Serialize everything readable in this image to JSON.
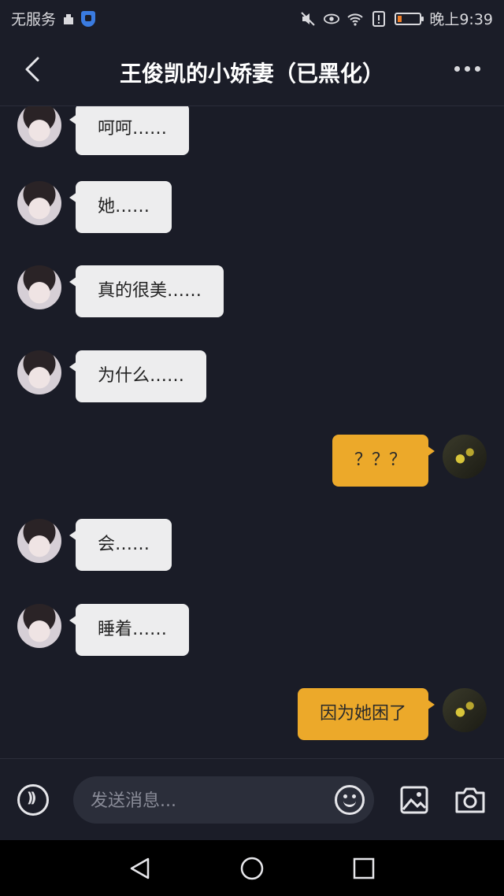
{
  "status_bar": {
    "carrier": "无服务",
    "time": "晚上9:39",
    "battery_level": 0.2,
    "icons": [
      "usb-icon",
      "shield-icon",
      "mute-icon",
      "eye-icon",
      "wifi-icon",
      "alert-icon",
      "battery-icon"
    ]
  },
  "header": {
    "title": "王俊凯的小娇妻（已黑化）",
    "back_icon": "chevron-left-icon",
    "more_icon": "more-dots-icon"
  },
  "messages": [
    {
      "side": "in",
      "text": "呵呵……"
    },
    {
      "side": "in",
      "text": "她……"
    },
    {
      "side": "in",
      "text": "真的很美……"
    },
    {
      "side": "in",
      "text": "为什么……"
    },
    {
      "side": "out",
      "text": "？？？"
    },
    {
      "side": "in",
      "text": "会……"
    },
    {
      "side": "in",
      "text": "睡着……"
    },
    {
      "side": "out",
      "text": "因为她困了"
    }
  ],
  "input_bar": {
    "placeholder": "发送消息...",
    "icons": [
      "voice-icon",
      "emoji-icon",
      "image-icon",
      "camera-icon"
    ]
  },
  "nav_bar": {
    "icons": [
      "back-triangle-icon",
      "home-circle-icon",
      "recents-square-icon"
    ]
  },
  "colors": {
    "background": "#1a1c27",
    "incoming_bubble": "#ededee",
    "outgoing_bubble": "#eca92a",
    "battery_fill": "#f07e28"
  }
}
